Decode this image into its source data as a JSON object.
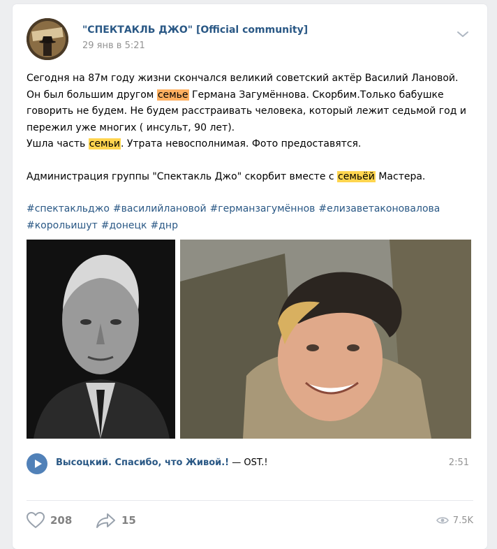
{
  "post": {
    "author": "\"СПЕКТАКЛЬ ДЖО\" [Official community]",
    "date": "29 янв в 5:21",
    "text": {
      "p1_a": "Сегодня на 87м году жизни скончался великий советский актёр Василий Лановой. Он был большим другом ",
      "p1_hl": "семье",
      "p1_b": " Германа Загумённова. Скорбим.Только бабушке говорить не будем. Не будем расстраивать человека, который лежит седьмой год и пережил уже многих ( инсульт, 90 лет).",
      "p2_a": "Ушла часть ",
      "p2_hl": "семьи",
      "p2_b": ". Утрата невосполнимая. Фото предоставятся.",
      "p3_a": "Администрация группы \"Спектакль Джо\" скорбит вместе с ",
      "p3_hl": "семьёй",
      "p3_b": " Мастера."
    },
    "hashtags": [
      "#спектакльджо",
      "#василийлановой",
      "#германзагумённов",
      "#елизаветаконовалова",
      "#корольишут",
      "#донецк",
      "#днр"
    ],
    "audio": {
      "artist": "Высоцкий. Спасибо, что Живой.!",
      "separator": "—",
      "title": "OST.!",
      "duration": "2:51"
    },
    "footer": {
      "likes": "208",
      "shares": "15",
      "views": "7.5K"
    }
  },
  "colors": {
    "link": "#2a5885",
    "highlight_orange": "#ffb060",
    "highlight_yellow": "#ffd54f",
    "accent": "#5181b8"
  },
  "icons": [
    "chevron-down-icon",
    "play-icon",
    "heart-icon",
    "share-icon",
    "eye-icon"
  ]
}
